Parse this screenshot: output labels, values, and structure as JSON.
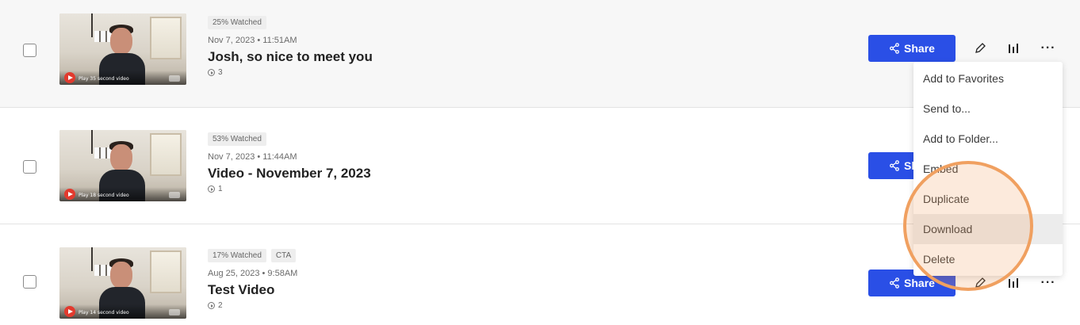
{
  "videos": [
    {
      "watched": "25% Watched",
      "tags": [],
      "date": "Nov 7, 2023 • 11:51AM",
      "title": "Josh, so nice to meet you",
      "views": "3",
      "thumb_label": "Play 35 second video"
    },
    {
      "watched": "53% Watched",
      "tags": [],
      "date": "Nov 7, 2023 • 11:44AM",
      "title": "Video - November 7, 2023",
      "views": "1",
      "thumb_label": "Play 18 second video"
    },
    {
      "watched": "17% Watched",
      "tags": [
        "CTA"
      ],
      "date": "Aug 25, 2023 • 9:58AM",
      "title": "Test Video",
      "views": "2",
      "thumb_label": "Play 14 second video"
    }
  ],
  "actions": {
    "share_label": "Share",
    "edit_icon": "pencil-icon",
    "insights_icon": "bar-chart-icon",
    "more_icon": "more-dots-icon",
    "accent": "#2a4fe6"
  },
  "menu": {
    "items": [
      "Add to Favorites",
      "Send to...",
      "Add to Folder...",
      "Embed",
      "Duplicate",
      "Download",
      "Delete"
    ],
    "highlighted": "Download"
  },
  "annotation": {
    "color": "#f0a060"
  }
}
